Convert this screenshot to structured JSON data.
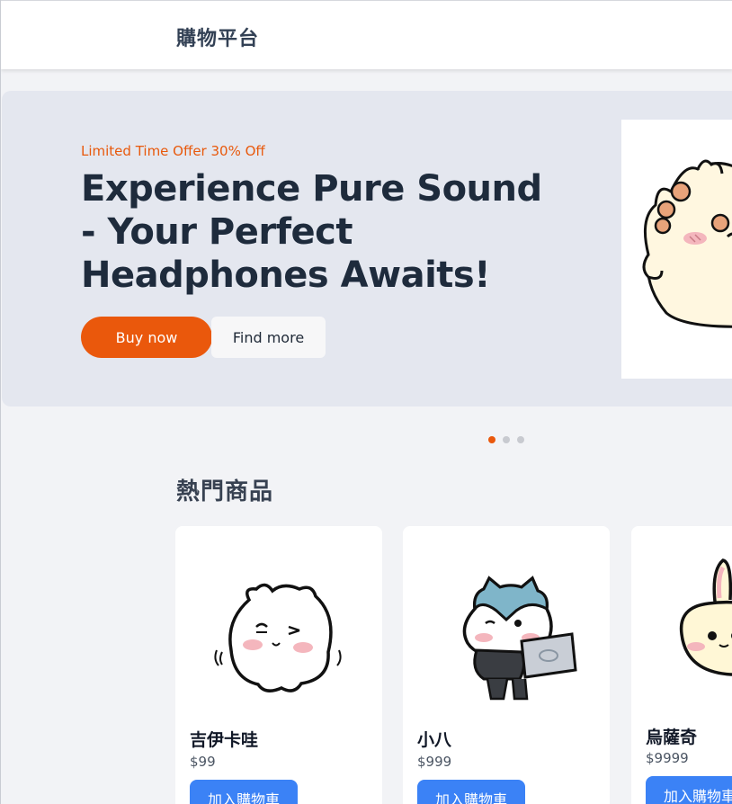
{
  "header": {
    "brand": "購物平台"
  },
  "hero": {
    "promo": "Limited Time Offer 30% Off",
    "headline": "Experience Pure Sound - Your Perfect Headphones Awaits!",
    "buy_label": "Buy now",
    "find_label": "Find more",
    "image_icon": "hamster-character-icon"
  },
  "carousel": {
    "slides": 3,
    "active_index": 0
  },
  "section": {
    "title": "熱門商品"
  },
  "products": [
    {
      "name": "吉伊卡哇",
      "price": "$99",
      "button": "加入購物車",
      "icon": "chiikawa-icon"
    },
    {
      "name": "小八",
      "price": "$999",
      "button": "加入購物車",
      "icon": "hachiware-laptop-icon"
    },
    {
      "name": "烏薩奇",
      "price": "$9999",
      "button": "加入購物車",
      "icon": "usagi-rabbit-icon"
    }
  ],
  "colors": {
    "accent": "#ea580c",
    "primary_button": "#3b82f6",
    "hero_bg": "#e4e7ef",
    "page_bg": "#f2f3f6"
  }
}
